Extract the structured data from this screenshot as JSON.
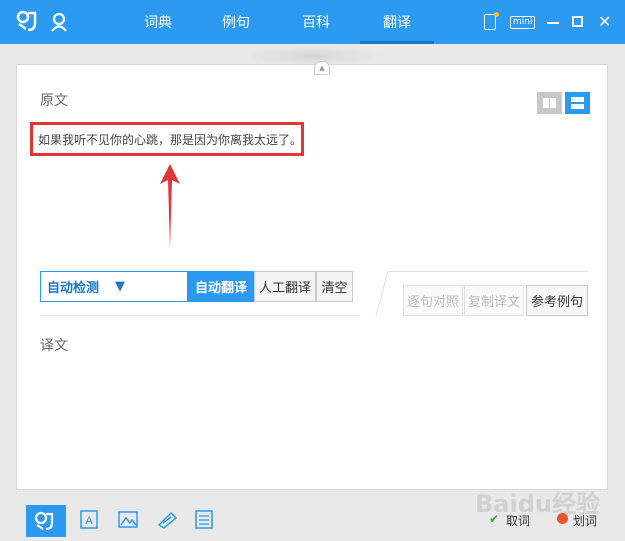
{
  "app": {
    "nav_tabs": [
      {
        "label": "词典",
        "active": false
      },
      {
        "label": "例句",
        "active": false
      },
      {
        "label": "百科",
        "active": false
      },
      {
        "label": "翻译",
        "active": true
      }
    ],
    "window_controls": {
      "mini_label": "mini"
    }
  },
  "source": {
    "heading": "原文",
    "text": "如果我听不见你的心跳，那是因为你离我太远了。"
  },
  "toolbar": {
    "language_select": "自动检测",
    "auto_translate": "自动翻译",
    "human_translate": "人工翻译",
    "clear": "清空",
    "sentence_compare": "逐句对照",
    "copy_translation": "复制译文",
    "reference_examples": "参考例句"
  },
  "target": {
    "heading": "译文"
  },
  "bottom": {
    "fetch_word": "取词",
    "select_word": "划词"
  },
  "watermark": "Baidu经验",
  "colors": {
    "accent": "#2c9af0",
    "highlight": "#e23636"
  }
}
